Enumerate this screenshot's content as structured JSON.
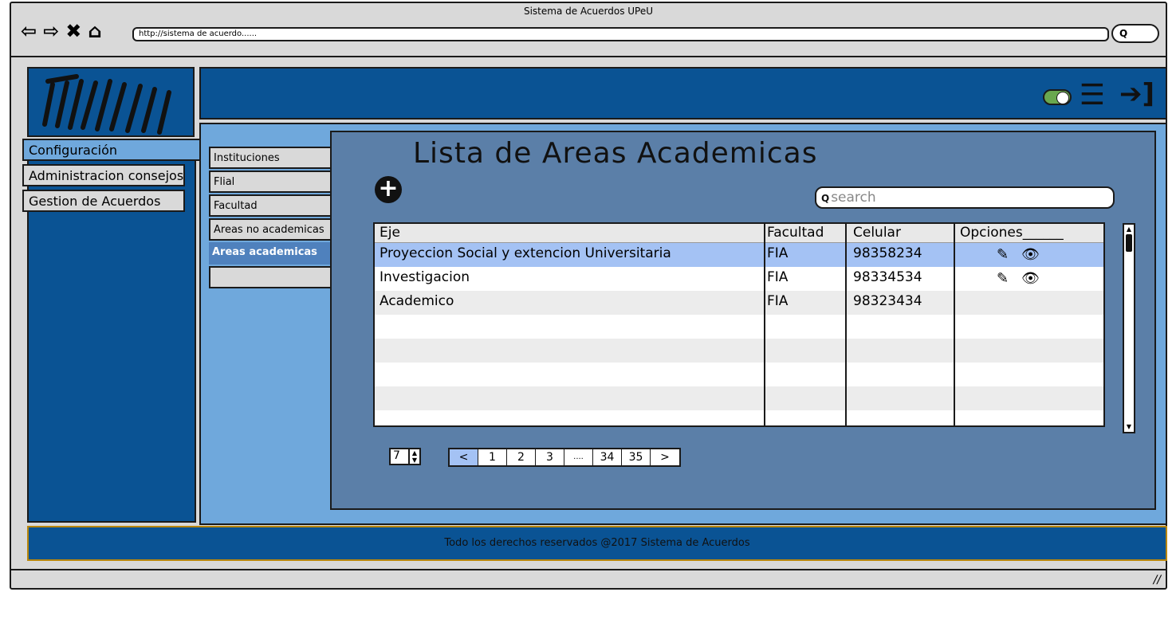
{
  "window": {
    "title": "Sistema de Acuerdos UPeU"
  },
  "browser": {
    "nav_icons": [
      "back-arrow-icon",
      "forward-arrow-icon",
      "close-icon",
      "home-icon"
    ],
    "url": "http://sistema de acuerdo......",
    "search_button": "Q"
  },
  "sidebar": {
    "items": [
      {
        "label": "Configuración",
        "active": true
      },
      {
        "label": "Administracion consejos",
        "active": false
      },
      {
        "label": "Gestion de Acuerdos",
        "active": false
      }
    ]
  },
  "header": {
    "icons": [
      "toggle-switch-icon",
      "menu-icon",
      "logout-icon"
    ]
  },
  "subnav": {
    "items": [
      {
        "label": "Instituciones",
        "active": false
      },
      {
        "label": "Flial",
        "active": false
      },
      {
        "label": "Facultad",
        "active": false
      },
      {
        "label": "Areas no academicas",
        "active": false
      },
      {
        "label": "Areas academicas",
        "active": true
      },
      {
        "label": "",
        "active": false
      }
    ]
  },
  "main": {
    "title": "Lista de Areas Academicas",
    "add_icon": "plus-circle-icon",
    "search": {
      "placeholder": "search"
    },
    "table": {
      "columns": [
        "Eje",
        "Facultad",
        "Celular",
        "Opciones______"
      ],
      "rows": [
        {
          "eje": "Proyeccion Social y extencion Universitaria",
          "facultad": "FIA",
          "celular": "98358234",
          "options": true,
          "selected": true
        },
        {
          "eje": "Investigacion",
          "facultad": "FIA",
          "celular": "98334534",
          "options": true,
          "selected": false
        },
        {
          "eje": "Academico",
          "facultad": "FIA",
          "celular": "98323434",
          "options": false,
          "selected": false
        }
      ]
    },
    "pagination": {
      "page_size": "7",
      "pages": [
        "<",
        "1",
        "2",
        "3",
        "....",
        "34",
        "35",
        ">"
      ],
      "current": "<"
    }
  },
  "footer": {
    "text": "Todo los derechos reservados @2017 Sistema de Acuerdos"
  },
  "colors": {
    "dark_blue": "#0a5394",
    "light_blue": "#6fa8dc",
    "content_blue": "#5b7fa8",
    "selected_row": "#a4c2f4"
  }
}
